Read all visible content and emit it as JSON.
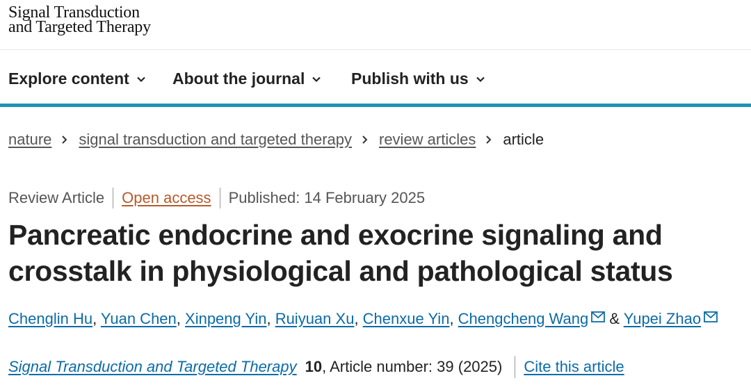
{
  "header": {
    "logo_line1": "Signal Transduction",
    "logo_line2": "and Targeted Therapy"
  },
  "nav": {
    "items": [
      {
        "label": "Explore content"
      },
      {
        "label": "About the journal"
      },
      {
        "label": "Publish with us"
      }
    ]
  },
  "breadcrumb": {
    "items": [
      "nature",
      "signal transduction and targeted therapy",
      "review articles"
    ],
    "current": "article"
  },
  "article": {
    "type": "Review Article",
    "access": "Open access",
    "published": "Published: 14 February 2025",
    "title": "Pancreatic endocrine and exocrine signaling and crosstalk in physiological and pathological status",
    "authors": [
      "Chenglin Hu",
      "Yuan Chen",
      "Xinpeng Yin",
      "Ruiyuan Xu",
      "Chenxue Yin",
      "Chengcheng Wang",
      "Yupei Zhao"
    ],
    "author_and": "&",
    "journal": "Signal Transduction and Targeted Therapy",
    "volume": "10",
    "article_number": ", Article number: 39 (2025)",
    "cite_label": "Cite this article"
  },
  "colors": {
    "accent_bar": "#1d93b3",
    "link": "#0b6ba8",
    "open_access": "#b55a2a"
  },
  "icons": {
    "chevron": "chevron-down-icon",
    "separator": "chevron-right-icon",
    "email": "mail-icon"
  }
}
